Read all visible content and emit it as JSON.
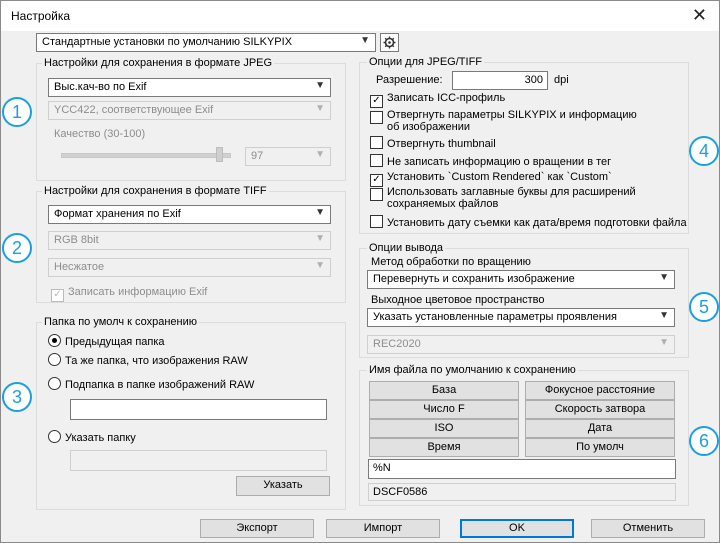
{
  "window": {
    "title": "Настройка",
    "close_glyph": "✕"
  },
  "preset": {
    "value": "Стандартные установки по умолчанию SILKYPIX",
    "settings_icon": "gear-icon"
  },
  "jpeg_save": {
    "group_label": "Настройки для сохранения в формате JPEG",
    "mode_value": "Выс.кач-во по Exif",
    "color_value": "YCC422, соответствующее Exif",
    "quality_label": "Качество (30-100)",
    "quality_value": "97",
    "quality_level": 0.97
  },
  "tiff_save": {
    "group_label": "Настройки для сохранения в формате TIFF",
    "format_value": "Формат хранения по Exif",
    "bit_value": "RGB 8bit",
    "compress_value": "Несжатое",
    "exif_label": "Записать информацию Exif"
  },
  "folder": {
    "group_label": "Папка по умолч к сохранению",
    "opt_prev": "Предыдущая папка",
    "opt_same": "Та же папка, что изображения RAW",
    "opt_sub": "Подпапка в папке изображений RAW",
    "sub_value": "",
    "opt_specify": "Указать папку",
    "specify_value": "",
    "specify_button": "Указать"
  },
  "jpeg_tiff_opts": {
    "group_label": "Опции для JPEG/TIFF",
    "resolution_label": "Разрешение:",
    "resolution_value": "300",
    "resolution_unit": "dpi",
    "icc": "Записать ICC-профиль",
    "reject_params": "Отвергнуть параметры SILKYPIX и информацию об изображении",
    "reject_thumb": "Отвергнуть thumbnail",
    "no_rotation": "Не записать информацию о вращении в тег",
    "custom_rendered": "Установить `Custom Rendered` как `Custom`",
    "uppercase_ext": "Использовать заглавные буквы для расширений сохраняемых файлов",
    "shoot_date": "Установить дату съемки как дата/время подготовки файла"
  },
  "output": {
    "group_label": "Опции вывода",
    "rotation_label": "Метод обработки по вращению",
    "rotation_value": "Перевернуть и сохранить изображение",
    "colorspace_label": "Выходное цветовое пространство",
    "colorspace_value": "Указать установленные параметры проявления",
    "rec_value": "REC2020"
  },
  "filename": {
    "group_label": "Имя файла по умолчанию к сохранению",
    "buttons": [
      "База",
      "Фокусное расстояние",
      "Число F",
      "Скорость затвора",
      "ISO",
      "Дата",
      "Время",
      "По умолч"
    ],
    "pattern_value": "%N",
    "preview_value": "DSCF0586"
  },
  "footer": {
    "export": "Экспорт",
    "import": "Импорт",
    "ok": "OK",
    "cancel": "Отменить"
  },
  "badges": [
    "1",
    "2",
    "3",
    "4",
    "5",
    "6"
  ],
  "colors": {
    "accent": "#1a9fe0",
    "default_button": "#0078d7"
  }
}
